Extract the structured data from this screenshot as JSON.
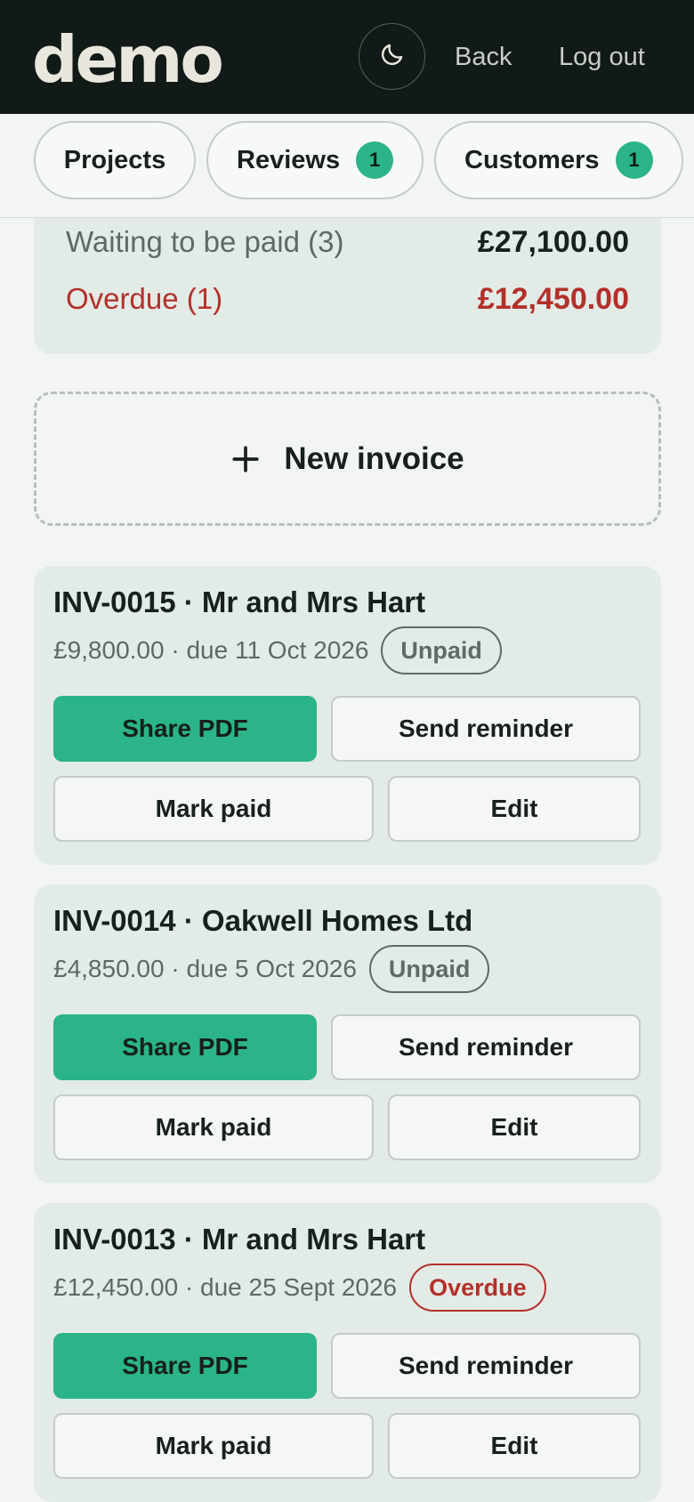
{
  "header": {
    "logo": "demo",
    "theme_icon": "moon-icon",
    "back_label": "Back",
    "logout_label": "Log out"
  },
  "tabs": [
    {
      "label": "Projects",
      "badge": null
    },
    {
      "label": "Reviews",
      "badge": "1"
    },
    {
      "label": "Customers",
      "badge": "1"
    }
  ],
  "summary": {
    "waiting_label": "Waiting to be paid (3)",
    "waiting_amount": "£27,100.00",
    "overdue_label": "Overdue (1)",
    "overdue_amount": "£12,450.00"
  },
  "new_invoice": {
    "label": "New invoice",
    "icon": "plus-icon"
  },
  "invoices": [
    {
      "title": "INV-0015 · Mr and Mrs Hart",
      "meta": "£9,800.00 · due 11 Oct 2026",
      "status": "Unpaid",
      "share_label": "Share PDF",
      "reminder_label": "Send reminder",
      "paid_label": "Mark paid",
      "edit_label": "Edit"
    },
    {
      "title": "INV-0014 · Oakwell Homes Ltd",
      "meta": "£4,850.00 · due 5 Oct 2026",
      "status": "Unpaid",
      "share_label": "Share PDF",
      "reminder_label": "Send reminder",
      "paid_label": "Mark paid",
      "edit_label": "Edit"
    },
    {
      "title": "INV-0013 · Mr and Mrs Hart",
      "meta": "£12,450.00 · due 25 Sept 2026",
      "status": "Overdue",
      "share_label": "Share PDF",
      "reminder_label": "Send reminder",
      "paid_label": "Mark paid",
      "edit_label": "Edit"
    }
  ],
  "colors": {
    "header_bg": "#111a16",
    "accent": "#2bb489",
    "overdue": "#b3302a",
    "card_bg": "#e3ebe6",
    "page_bg": "#f2f5f3"
  }
}
